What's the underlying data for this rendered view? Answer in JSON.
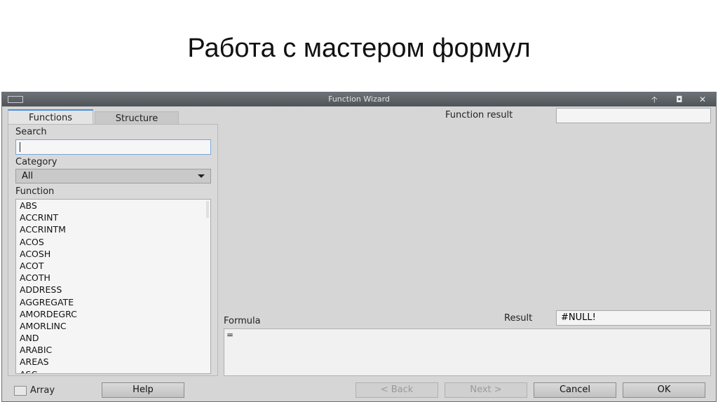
{
  "slide": {
    "title": "Работа с мастером формул"
  },
  "window": {
    "title": "Function Wizard",
    "controls": {
      "minimize": "🡡",
      "maximize": "◘",
      "close": "✕"
    }
  },
  "tabs": [
    {
      "label": "Functions"
    },
    {
      "label": "Structure"
    }
  ],
  "search": {
    "label": "Search",
    "value": ""
  },
  "category": {
    "label": "Category",
    "selected": "All"
  },
  "function_list": {
    "label": "Function",
    "items": [
      "ABS",
      "ACCRINT",
      "ACCRINTM",
      "ACOS",
      "ACOSH",
      "ACOT",
      "ACOTH",
      "ADDRESS",
      "AGGREGATE",
      "AMORDEGRC",
      "AMORLINC",
      "AND",
      "ARABIC",
      "AREAS",
      "ASC"
    ]
  },
  "function_result": {
    "label": "Function result",
    "value": ""
  },
  "formula": {
    "label": "Formula",
    "value": "="
  },
  "result": {
    "label": "Result",
    "value": "#NULL!"
  },
  "array": {
    "label": "Array"
  },
  "buttons": {
    "help": "Help",
    "back": "< Back",
    "next": "Next >",
    "cancel": "Cancel",
    "ok": "OK"
  },
  "icons": {
    "window_menu": "window-menu-icon",
    "dropdown": "chevron-down-icon"
  }
}
